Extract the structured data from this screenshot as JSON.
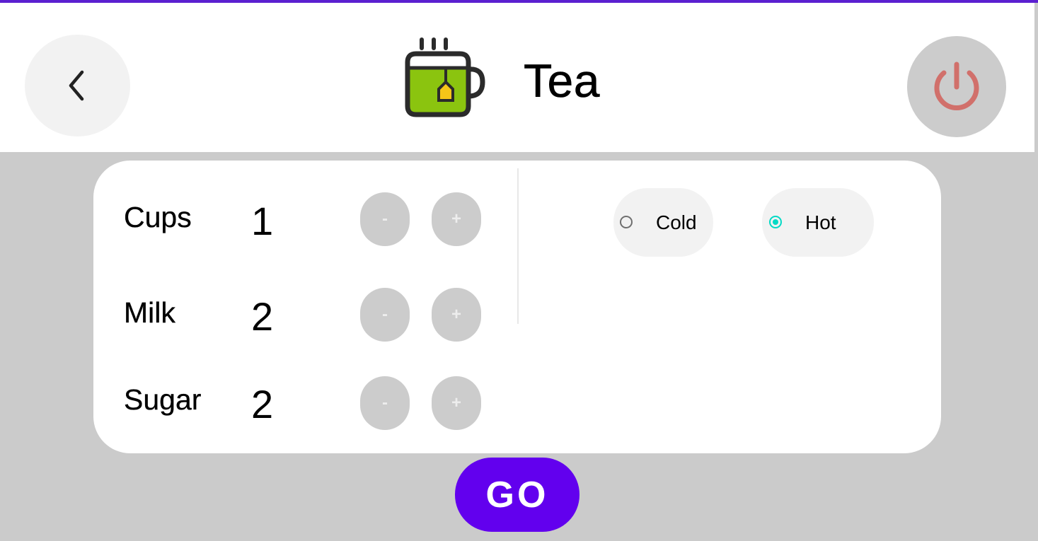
{
  "header": {
    "title": "Tea",
    "back_icon": "chevron-left-icon",
    "power_icon": "power-icon",
    "drink_icon": "tea-cup-icon"
  },
  "options": [
    {
      "label": "Cups",
      "value": "1",
      "decrement": "-",
      "increment": "+"
    },
    {
      "label": "Milk",
      "value": "2",
      "decrement": "-",
      "increment": "+"
    },
    {
      "label": "Sugar",
      "value": "2",
      "decrement": "-",
      "increment": "+"
    }
  ],
  "temperature": {
    "options": [
      {
        "label": "Cold",
        "selected": false
      },
      {
        "label": "Hot",
        "selected": true
      }
    ]
  },
  "actions": {
    "go_label": "GO"
  },
  "colors": {
    "accent": "#6200ee",
    "radio_selected": "#03dac5",
    "power_icon": "#d1706b",
    "tea_green": "#8bc40f"
  }
}
